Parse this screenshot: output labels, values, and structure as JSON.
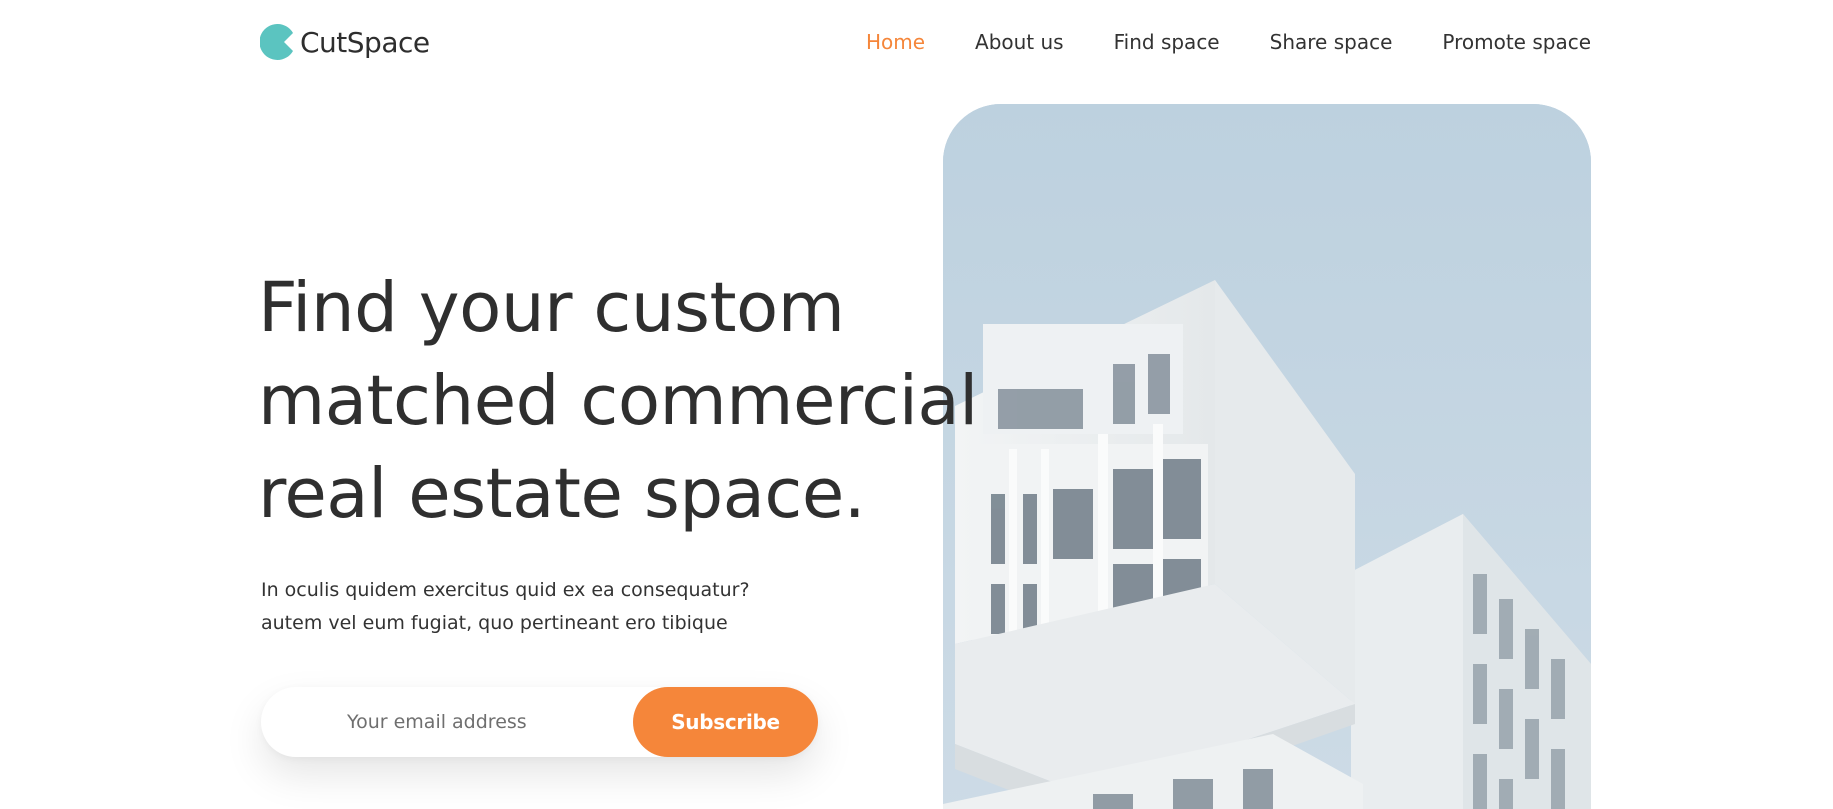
{
  "brand": {
    "name": "CutSpace",
    "logo_icon": "crescent-logo-icon",
    "logo_color": "#5bc4c0"
  },
  "nav": {
    "items": [
      {
        "label": "Home",
        "active": true
      },
      {
        "label": "About us",
        "active": false
      },
      {
        "label": "Find space",
        "active": false
      },
      {
        "label": "Share space",
        "active": false
      },
      {
        "label": "Promote space",
        "active": false
      }
    ]
  },
  "hero": {
    "title_lines": [
      "Find your custom",
      "matched commercial",
      "real estate space."
    ],
    "subtitle_lines": [
      "In oculis quidem exercitus quid ex ea consequatur?",
      "autem vel eum fugiat, quo pertineant ero tibique"
    ],
    "email_placeholder": "Your email address",
    "email_value": "",
    "subscribe_label": "Subscribe",
    "image_subject": "modern-white-building-photo"
  },
  "colors": {
    "accent": "#f5863a",
    "text": "#2f2f2f",
    "sky": "#c2d5e2"
  }
}
